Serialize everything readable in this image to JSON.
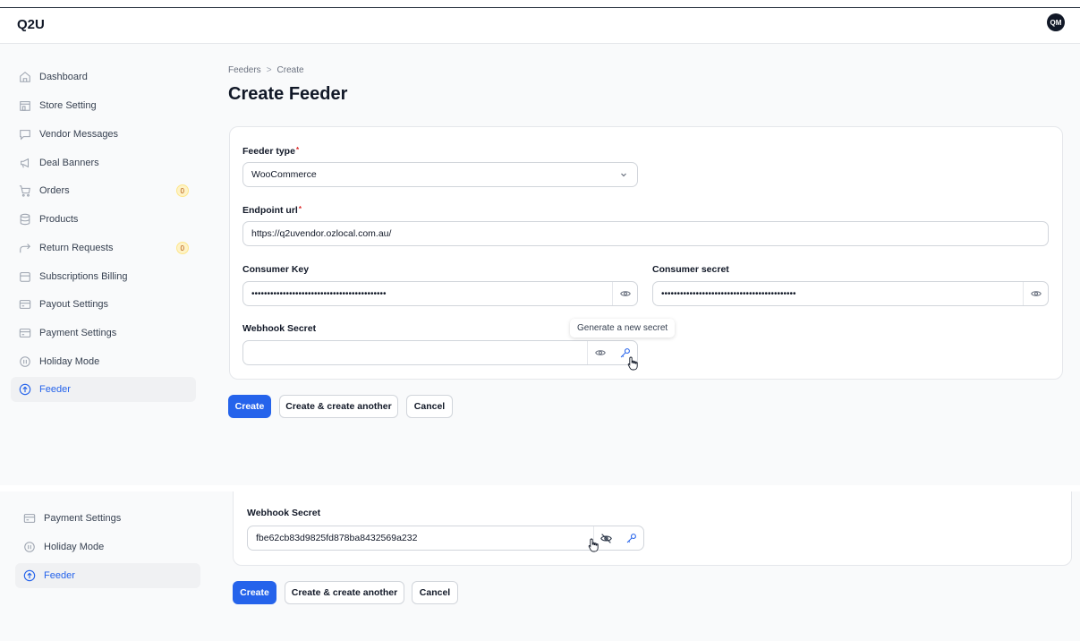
{
  "app": {
    "name": "Q2U",
    "avatar_initials": "QM"
  },
  "sidebar": {
    "items": [
      {
        "label": "Dashboard",
        "icon": "home-icon"
      },
      {
        "label": "Store Setting",
        "icon": "store-icon"
      },
      {
        "label": "Vendor Messages",
        "icon": "chat-icon"
      },
      {
        "label": "Deal Banners",
        "icon": "megaphone-icon"
      },
      {
        "label": "Orders",
        "icon": "cart-icon",
        "badge": "0"
      },
      {
        "label": "Products",
        "icon": "database-icon"
      },
      {
        "label": "Return Requests",
        "icon": "return-arrow-icon",
        "badge": "0"
      },
      {
        "label": "Subscriptions Billing",
        "icon": "box-icon"
      },
      {
        "label": "Payout Settings",
        "icon": "card-icon"
      },
      {
        "label": "Payment Settings",
        "icon": "card-icon"
      },
      {
        "label": "Holiday Mode",
        "icon": "pause-icon"
      },
      {
        "label": "Feeder",
        "icon": "upload-cloud-icon",
        "active": true
      }
    ]
  },
  "breadcrumb": {
    "parent": "Feeders",
    "separator": ">",
    "current": "Create"
  },
  "page": {
    "title": "Create Feeder"
  },
  "form": {
    "feeder_type": {
      "label": "Feeder type",
      "required_mark": "*",
      "value": "WooCommerce"
    },
    "endpoint_url": {
      "label": "Endpoint url",
      "required_mark": "*",
      "value": "https://q2uvendor.ozlocal.com.au/"
    },
    "consumer_key": {
      "label": "Consumer Key",
      "value": "•••••••••••••••••••••••••••••••••••••••••••"
    },
    "consumer_secret": {
      "label": "Consumer secret",
      "value": "•••••••••••••••••••••••••••••••••••••••••••"
    },
    "webhook_secret": {
      "label": "Webhook Secret",
      "value": ""
    },
    "generate_tooltip": "Generate a new secret"
  },
  "actions": {
    "create": "Create",
    "create_another": "Create & create another",
    "cancel": "Cancel"
  },
  "lower_panel": {
    "sidebar_items": [
      {
        "label": "Payment Settings",
        "icon": "card-icon"
      },
      {
        "label": "Holiday Mode",
        "icon": "pause-icon"
      },
      {
        "label": "Feeder",
        "icon": "upload-cloud-icon",
        "active": true
      }
    ],
    "webhook_secret": {
      "label": "Webhook Secret",
      "value": "fbe62cb83d9825fd878ba8432569a232"
    },
    "actions": {
      "create": "Create",
      "create_another": "Create & create another",
      "cancel": "Cancel"
    }
  },
  "colors": {
    "accent": "#2563eb",
    "badge_bg": "#fef3c7",
    "badge_text": "#b45309",
    "required": "#dc2626"
  }
}
